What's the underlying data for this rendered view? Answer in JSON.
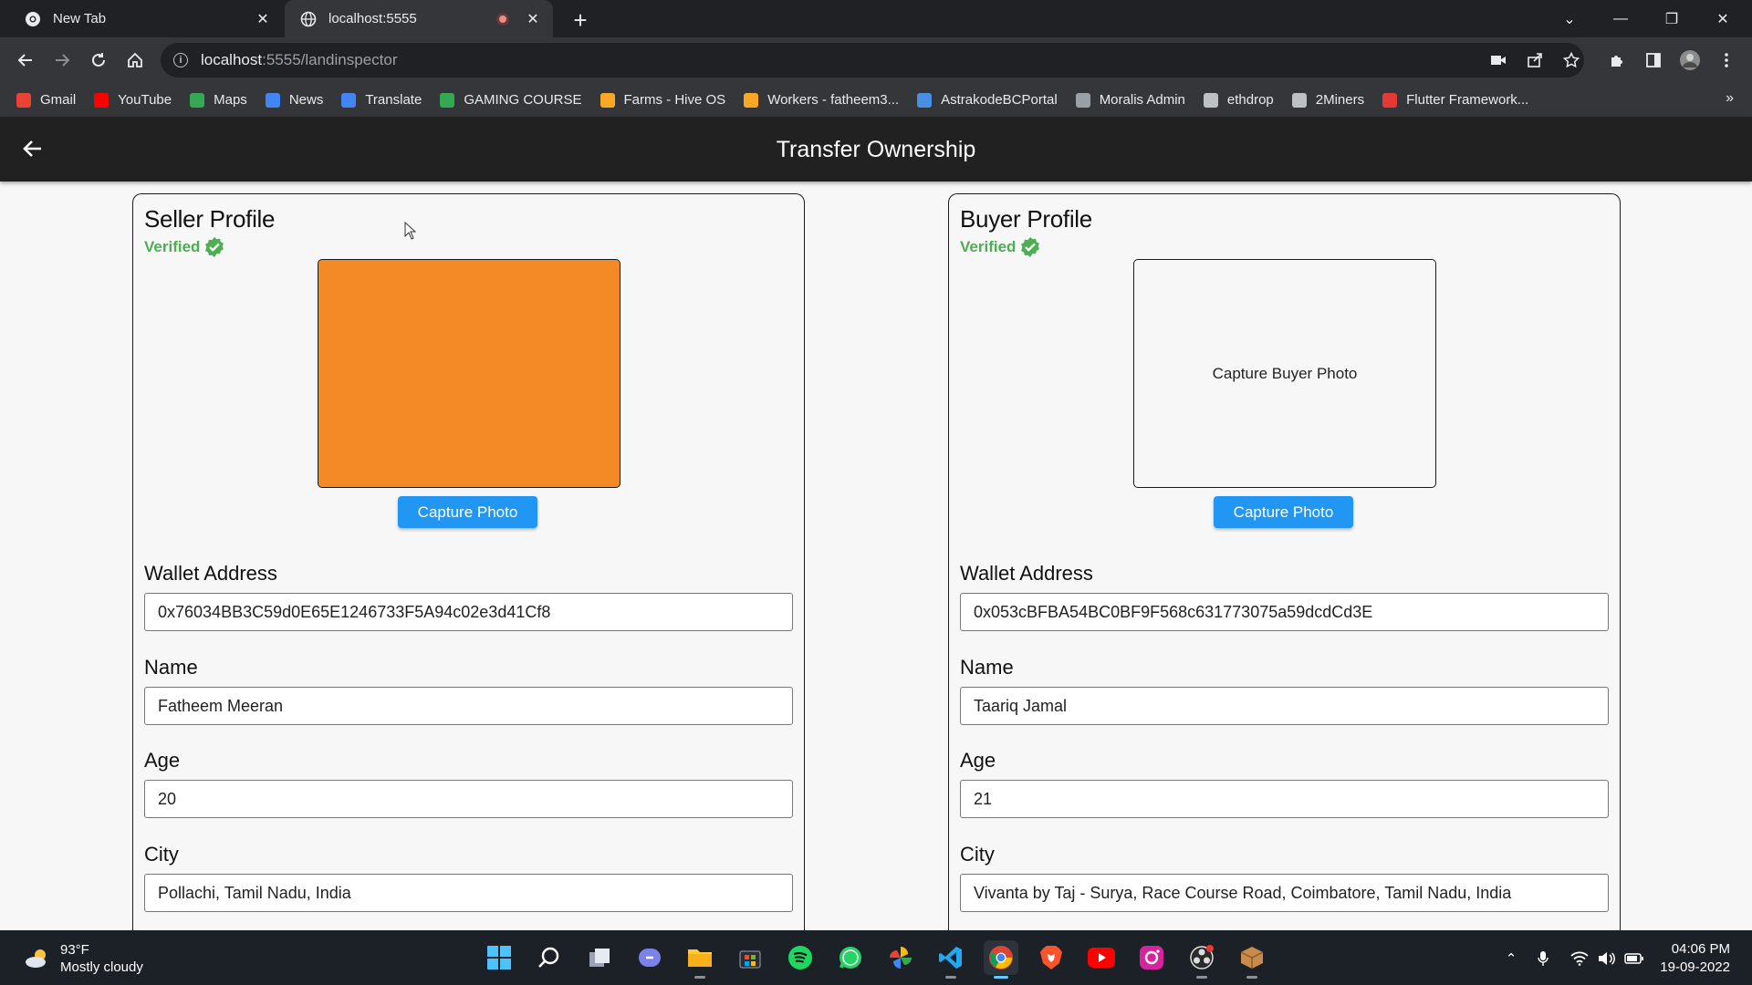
{
  "browser": {
    "tabs": [
      {
        "title": "New Tab",
        "active": false
      },
      {
        "title": "localhost:5555",
        "active": true
      }
    ],
    "url_host": "localhost",
    "url_rest": ":5555/landinspector",
    "bookmarks": [
      {
        "label": "Gmail",
        "icon": "gmail-icon",
        "color": "#ea4335"
      },
      {
        "label": "YouTube",
        "icon": "youtube-icon",
        "color": "#ff0000"
      },
      {
        "label": "Maps",
        "icon": "maps-icon",
        "color": "#34a853"
      },
      {
        "label": "News",
        "icon": "news-icon",
        "color": "#4285f4"
      },
      {
        "label": "Translate",
        "icon": "translate-icon",
        "color": "#4285f4"
      },
      {
        "label": "GAMING COURSE",
        "icon": "bars-icon",
        "color": "#34a853"
      },
      {
        "label": "Farms - Hive OS",
        "icon": "hive-icon",
        "color": "#f9a825"
      },
      {
        "label": "Workers - fatheem3...",
        "icon": "hive-icon",
        "color": "#f9a825"
      },
      {
        "label": "AstrakodeBCPortal",
        "icon": "link-icon",
        "color": "#4a90e2"
      },
      {
        "label": "Moralis Admin",
        "icon": "moralis-icon",
        "color": "#9aa0a6"
      },
      {
        "label": "ethdrop",
        "icon": "ethereum-icon",
        "color": "#bdc1c6"
      },
      {
        "label": "2Miners",
        "icon": "2miners-icon",
        "color": "#bdc1c6"
      },
      {
        "label": "Flutter Framework...",
        "icon": "flutter-icon",
        "color": "#e53935"
      }
    ]
  },
  "app": {
    "title": "Transfer Ownership"
  },
  "seller": {
    "title": "Seller Profile",
    "verified_label": "Verified",
    "photo_color": "#f48a25",
    "capture_button": "Capture Photo",
    "wallet_label": "Wallet Address",
    "wallet_value": "0x76034BB3C59d0E65E1246733F5A94c02e3d41Cf8",
    "name_label": "Name",
    "name_value": "Fatheem Meeran",
    "age_label": "Age",
    "age_value": "20",
    "city_label": "City",
    "city_value": "Pollachi, Tamil Nadu, India"
  },
  "buyer": {
    "title": "Buyer Profile",
    "verified_label": "Verified",
    "photo_placeholder": "Capture Buyer Photo",
    "capture_button": "Capture Photo",
    "wallet_label": "Wallet Address",
    "wallet_value": "0x053cBFBA54BC0BF9F568c631773075a59dcdCd3E",
    "name_label": "Name",
    "name_value": "Taariq Jamal",
    "age_label": "Age",
    "age_value": "21",
    "city_label": "City",
    "city_value": "Vivanta by Taj - Surya, Race Course Road, Coimbatore, Tamil Nadu, India"
  },
  "taskbar": {
    "temperature": "93°F",
    "weather": "Mostly cloudy",
    "time": "04:06 PM",
    "date": "19-09-2022"
  },
  "colors": {
    "accent": "#2196f3",
    "verified": "#4caf50",
    "appbar": "#212121"
  }
}
